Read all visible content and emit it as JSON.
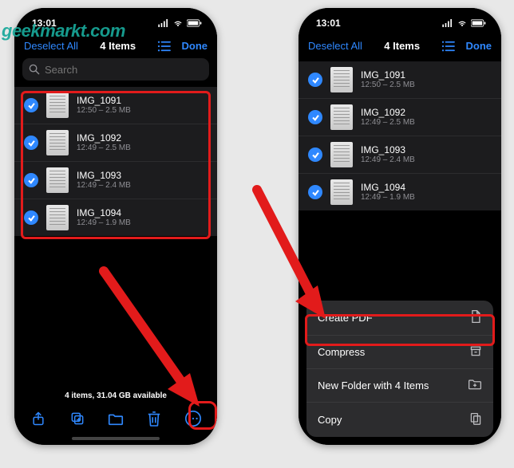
{
  "watermark": "geekmarkt.com",
  "status": {
    "time": "13:01"
  },
  "nav": {
    "deselect": "Deselect All",
    "title": "4 Items",
    "done": "Done"
  },
  "search": {
    "placeholder": "Search"
  },
  "files": [
    {
      "name": "IMG_1091",
      "meta": "12:50 – 2.5 MB"
    },
    {
      "name": "IMG_1092",
      "meta": "12:49 – 2.5 MB"
    },
    {
      "name": "IMG_1093",
      "meta": "12:49 – 2.4 MB"
    },
    {
      "name": "IMG_1094",
      "meta": "12:49 – 1.9 MB"
    }
  ],
  "footer": "4 items, 31.04 GB available",
  "menu": {
    "create_pdf": "Create PDF",
    "compress": "Compress",
    "new_folder": "New Folder with 4 Items",
    "copy": "Copy"
  }
}
